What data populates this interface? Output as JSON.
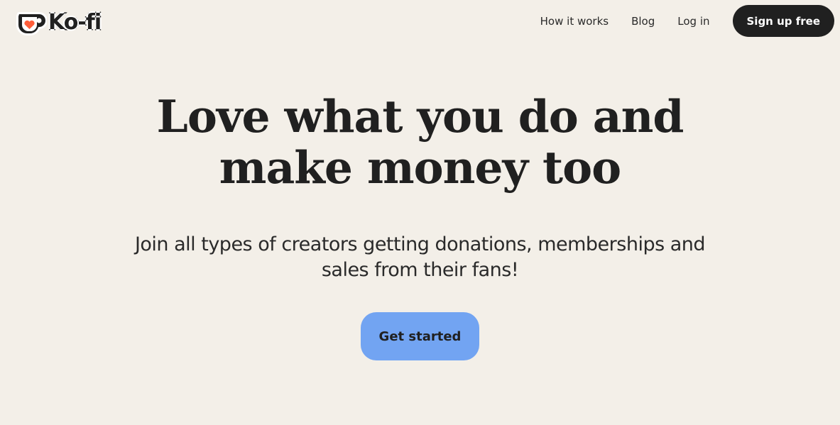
{
  "header": {
    "logo_text": "Ko-fi",
    "logo_icon": "coffee-cup-heart-icon",
    "nav": {
      "how_it_works": "How it works",
      "blog": "Blog",
      "login": "Log in",
      "signup": "Sign up free"
    }
  },
  "hero": {
    "title_line1": "Love what you do and",
    "title_line2": "make money too",
    "subtitle_line1": "Join all types of creators getting donations, memberships and",
    "subtitle_line2": "sales from their fans!",
    "cta": "Get started"
  },
  "colors": {
    "background": "#f3efe8",
    "text": "#202020",
    "cta": "#72a4f2",
    "heart": "#ff5e3a",
    "signup_bg": "#202020"
  }
}
